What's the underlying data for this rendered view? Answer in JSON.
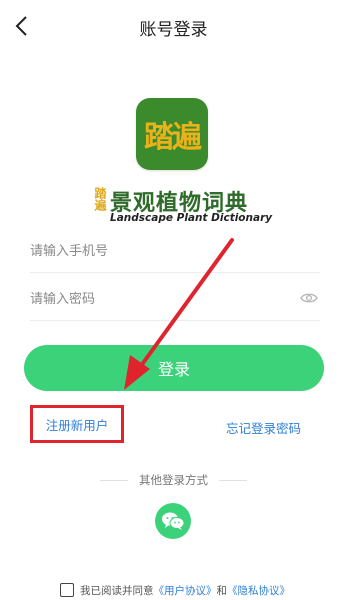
{
  "header": {
    "title": "账号登录",
    "back_icon": "chevron-left-icon"
  },
  "logo": {
    "text": "踏遍",
    "bg_color": "#3b8a2c",
    "text_color": "#e9b21a"
  },
  "brand": {
    "badge": "踏遍",
    "name_cn": "景观植物词典",
    "name_en": "Landscape Plant Dictionary"
  },
  "form": {
    "phone": {
      "placeholder": "请输入手机号",
      "value": ""
    },
    "password": {
      "placeholder": "请输入密码",
      "value": "",
      "toggle_icon": "eye-icon"
    }
  },
  "actions": {
    "login_label": "登录",
    "register_label": "注册新用户",
    "forgot_label": "忘记登录密码",
    "accent_color": "#3bd27a",
    "link_color": "#2f7fd8",
    "highlight_color": "#e0242e"
  },
  "other_login": {
    "label": "其他登录方式",
    "wechat_icon": "wechat-icon"
  },
  "agreement": {
    "prefix": "我已阅读并同意",
    "user_agreement": "《用户协议》",
    "conjunction": "和",
    "privacy_policy": "《隐私协议》",
    "checked": false
  }
}
